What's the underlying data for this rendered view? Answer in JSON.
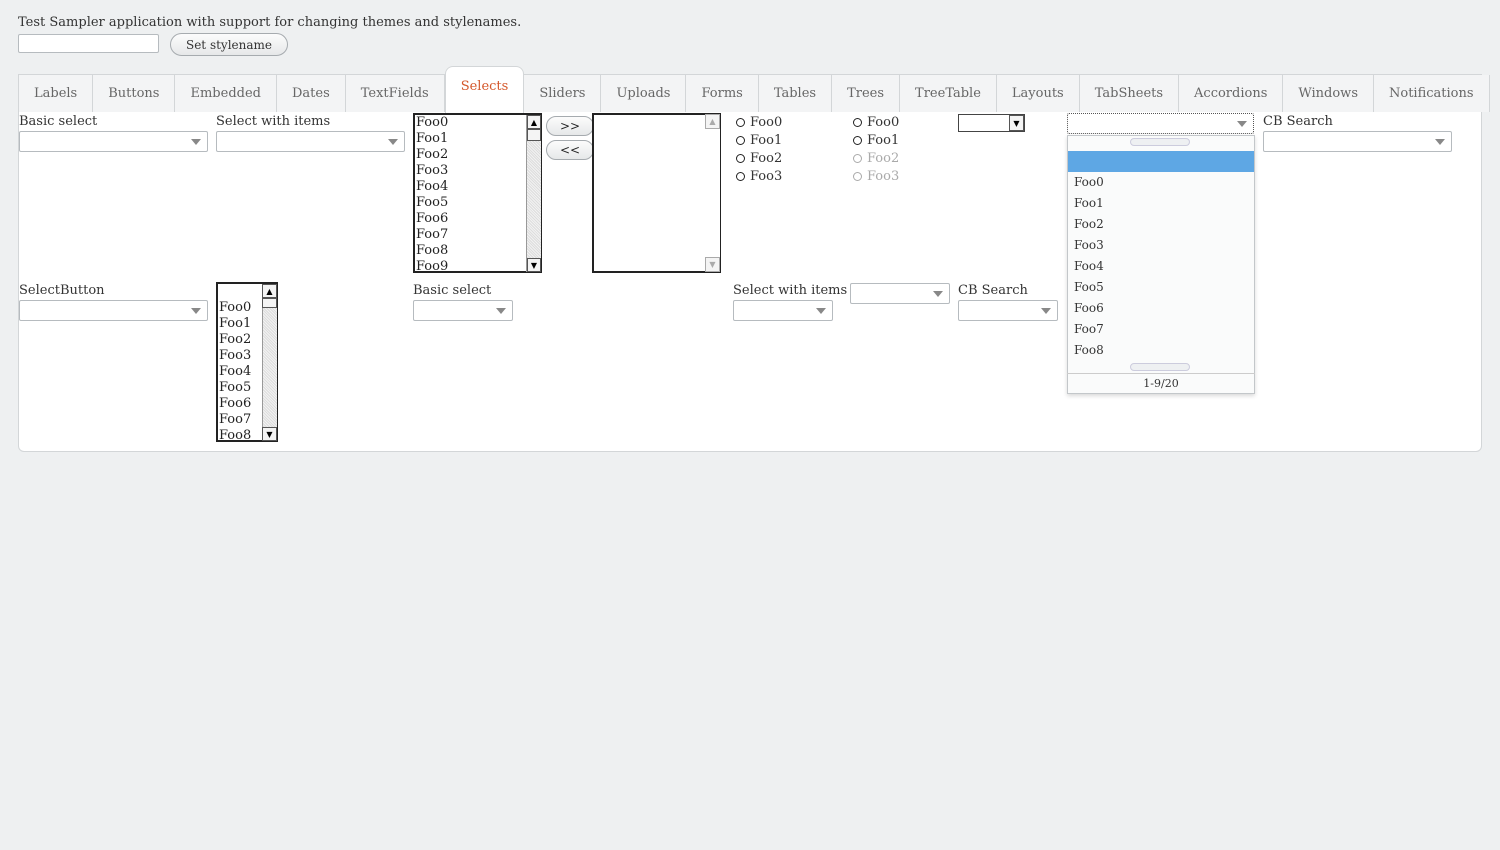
{
  "header": {
    "description": "Test Sampler application with support for changing themes and stylenames.",
    "stylename_input_value": "",
    "set_stylename_label": "Set stylename"
  },
  "tabs": [
    {
      "label": "Labels",
      "selected": false
    },
    {
      "label": "Buttons",
      "selected": false
    },
    {
      "label": "Embedded",
      "selected": false
    },
    {
      "label": "Dates",
      "selected": false
    },
    {
      "label": "TextFields",
      "selected": false
    },
    {
      "label": "Selects",
      "selected": true
    },
    {
      "label": "Sliders",
      "selected": false
    },
    {
      "label": "Uploads",
      "selected": false
    },
    {
      "label": "Forms",
      "selected": false
    },
    {
      "label": "Tables",
      "selected": false
    },
    {
      "label": "Trees",
      "selected": false
    },
    {
      "label": "TreeTable",
      "selected": false
    },
    {
      "label": "Layouts",
      "selected": false
    },
    {
      "label": "TabSheets",
      "selected": false
    },
    {
      "label": "Accordions",
      "selected": false
    },
    {
      "label": "Windows",
      "selected": false
    },
    {
      "label": "Notifications",
      "selected": false
    }
  ],
  "row1": {
    "basic_select_label": "Basic select",
    "select_with_items_label": "Select with items",
    "list_items": [
      "Foo0",
      "Foo1",
      "Foo2",
      "Foo3",
      "Foo4",
      "Foo5",
      "Foo6",
      "Foo7",
      "Foo8",
      "Foo9"
    ],
    "move_right_label": ">>",
    "move_left_label": "<<",
    "radio_group_a": [
      "Foo0",
      "Foo1",
      "Foo2",
      "Foo3"
    ],
    "radio_group_b": [
      "Foo0",
      "Foo1",
      "Foo2",
      "Foo3"
    ],
    "cb_search_label": "CB Search"
  },
  "row2": {
    "select_button_label": "SelectButton",
    "list_items": [
      "Foo0",
      "Foo1",
      "Foo2",
      "Foo3",
      "Foo4",
      "Foo5",
      "Foo6",
      "Foo7",
      "Foo8"
    ],
    "basic_select_label": "Basic select",
    "select_with_items_label": "Select with items",
    "cb_search_label": "CB Search"
  },
  "popup": {
    "items": [
      "",
      "Foo0",
      "Foo1",
      "Foo2",
      "Foo3",
      "Foo4",
      "Foo5",
      "Foo6",
      "Foo7",
      "Foo8"
    ],
    "status": "1-9/20"
  }
}
